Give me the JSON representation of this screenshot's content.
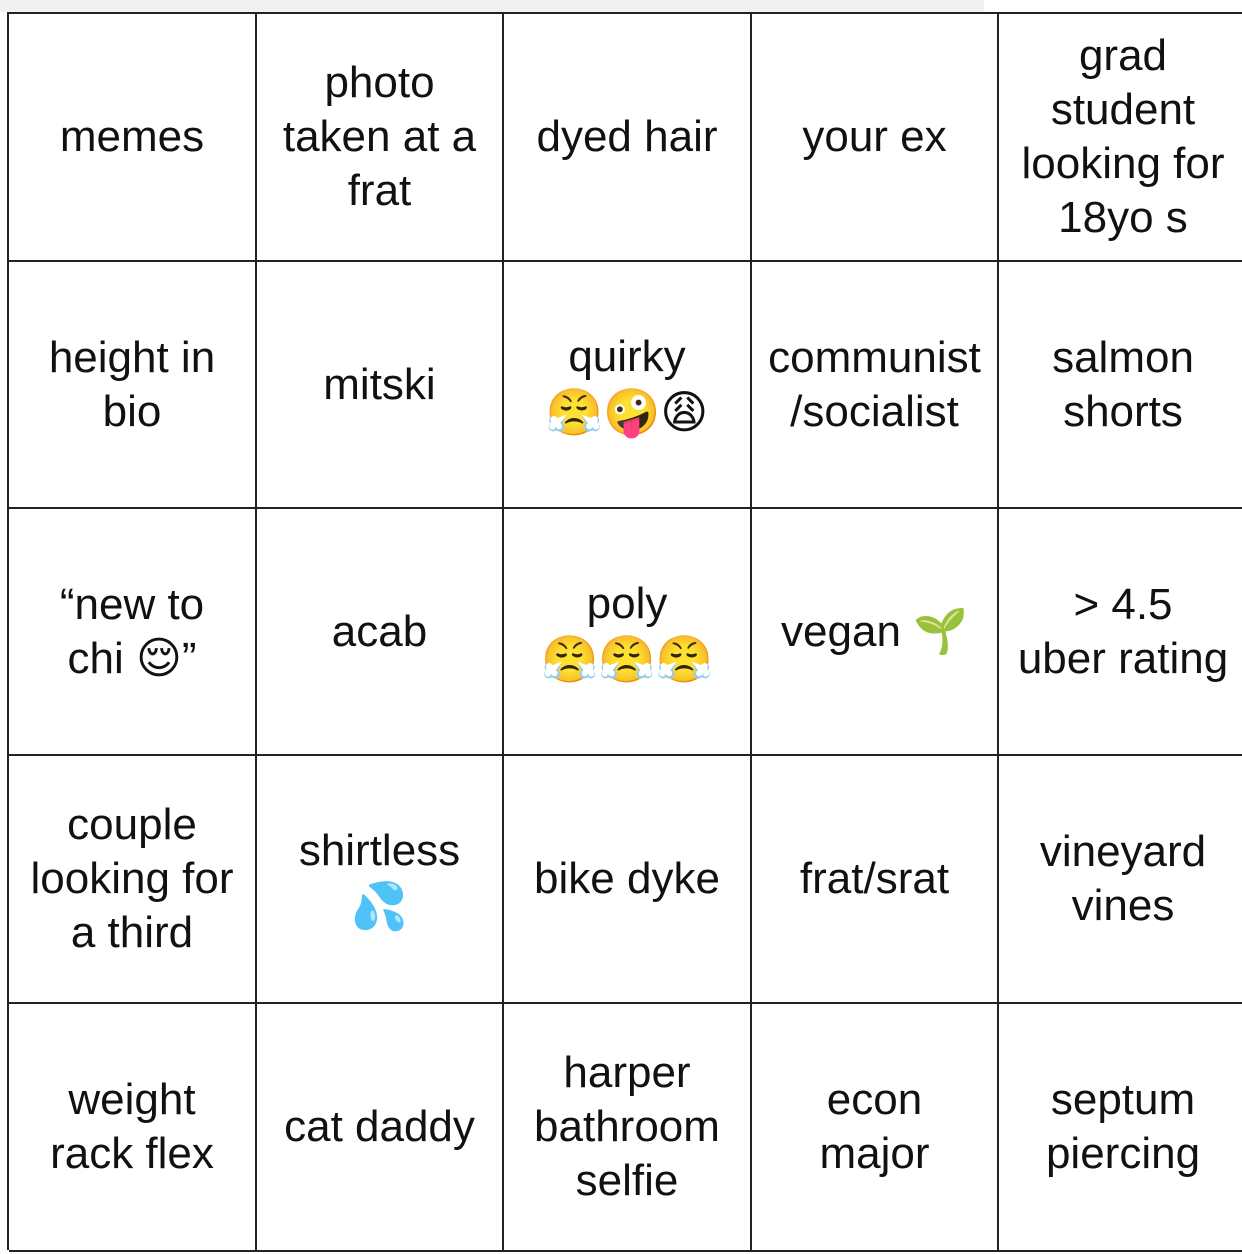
{
  "cells": [
    {
      "text": "memes",
      "emoji": ""
    },
    {
      "text": "photo\ntaken at a\nfrat",
      "emoji": ""
    },
    {
      "text": "dyed hair",
      "emoji": ""
    },
    {
      "text": "your ex",
      "emoji": ""
    },
    {
      "text": "grad\nstudent\nlooking for\n18yo s",
      "emoji": ""
    },
    {
      "text": "height in\nbio",
      "emoji": ""
    },
    {
      "text": "mitski",
      "emoji": ""
    },
    {
      "text": "quirky",
      "emoji": "😤🤪😩"
    },
    {
      "text": "communist\n/socialist",
      "emoji": ""
    },
    {
      "text": "salmon\nshorts",
      "emoji": ""
    },
    {
      "text": "“new to\nchi 😌”",
      "emoji": ""
    },
    {
      "text": "acab",
      "emoji": ""
    },
    {
      "text": "poly",
      "emoji": "😤😤😤"
    },
    {
      "text": "vegan 🌱",
      "emoji": ""
    },
    {
      "text": "> 4.5\nuber rating",
      "emoji": ""
    },
    {
      "text": "couple\nlooking for\na third",
      "emoji": ""
    },
    {
      "text": "shirtless",
      "emoji": "💦"
    },
    {
      "text": "bike dyke",
      "emoji": ""
    },
    {
      "text": "frat/srat",
      "emoji": ""
    },
    {
      "text": "vineyard\nvines",
      "emoji": ""
    },
    {
      "text": "weight\nrack flex",
      "emoji": ""
    },
    {
      "text": "cat daddy",
      "emoji": ""
    },
    {
      "text": "harper\nbathroom\nselfie",
      "emoji": ""
    },
    {
      "text": "econ\nmajor",
      "emoji": ""
    },
    {
      "text": "septum\npiercing",
      "emoji": ""
    }
  ]
}
